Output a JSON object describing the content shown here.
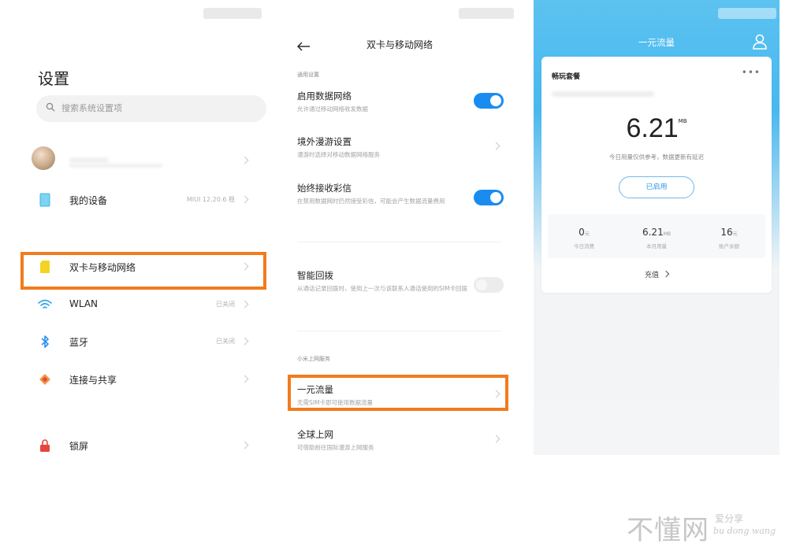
{
  "settings": {
    "title": "设置",
    "search_placeholder": "搜索系统设置项",
    "rows": [
      {
        "label": "我的设备",
        "value": "MIUI 12.20.6 稳",
        "icon": "device-icon"
      },
      {
        "label": "双卡与移动网络",
        "value": "",
        "icon": "sim-card-icon"
      },
      {
        "label": "WLAN",
        "value": "已关闭",
        "icon": "wifi-icon"
      },
      {
        "label": "蓝牙",
        "value": "已关闭",
        "icon": "bluetooth-icon"
      },
      {
        "label": "连接与共享",
        "value": "",
        "icon": "connection-share-icon"
      },
      {
        "label": "锁屏",
        "value": "",
        "icon": "lock-icon"
      }
    ]
  },
  "dual_sim": {
    "title": "双卡与移动网络",
    "section_general": "通用设置",
    "items": [
      {
        "title": "启用数据网络",
        "desc": "允许通过移动网络收发数据",
        "toggle": "on"
      },
      {
        "title": "境外漫游设置",
        "desc": "漫游时选择对移动数据网络服务"
      },
      {
        "title": "始终接收彩信",
        "desc": "在禁用数据网时仍然接受彩信，可能会产生数据流量费用",
        "toggle": "on"
      },
      {
        "title": "智能回拨",
        "desc": "从通话记录回拨时，使用上一次与该联系人通话使用的SIM卡回拨",
        "toggle": "off"
      }
    ],
    "section_services": "小米上网服务",
    "service_items": [
      {
        "title": "一元流量",
        "desc": "无需SIM卡即可使用数据流量"
      },
      {
        "title": "全球上网",
        "desc": "可借助前往国际漫游上网服务"
      }
    ]
  },
  "flow": {
    "title": "一元流量",
    "package_name": "畅玩套餐",
    "more": "•••",
    "usage_value": "6.21",
    "usage_unit": "MB",
    "tip": "今日用量仅供参考，数据更新有延迟",
    "status_button": "已启用",
    "stats": [
      {
        "value": "0",
        "unit": "元",
        "label": "今日消费"
      },
      {
        "value": "6.21",
        "unit": "MB",
        "label": "本月用量"
      },
      {
        "value": "16",
        "unit": "元",
        "label": "账户余额"
      }
    ],
    "recharge": "充值"
  },
  "watermark": {
    "main": "不懂网",
    "sub": "爱分享",
    "pinyin": "bu dong wang"
  },
  "colors": {
    "highlight": "#f27b1d",
    "toggle_on": "#1a8cf0",
    "flow_header": "#48b8ef"
  }
}
